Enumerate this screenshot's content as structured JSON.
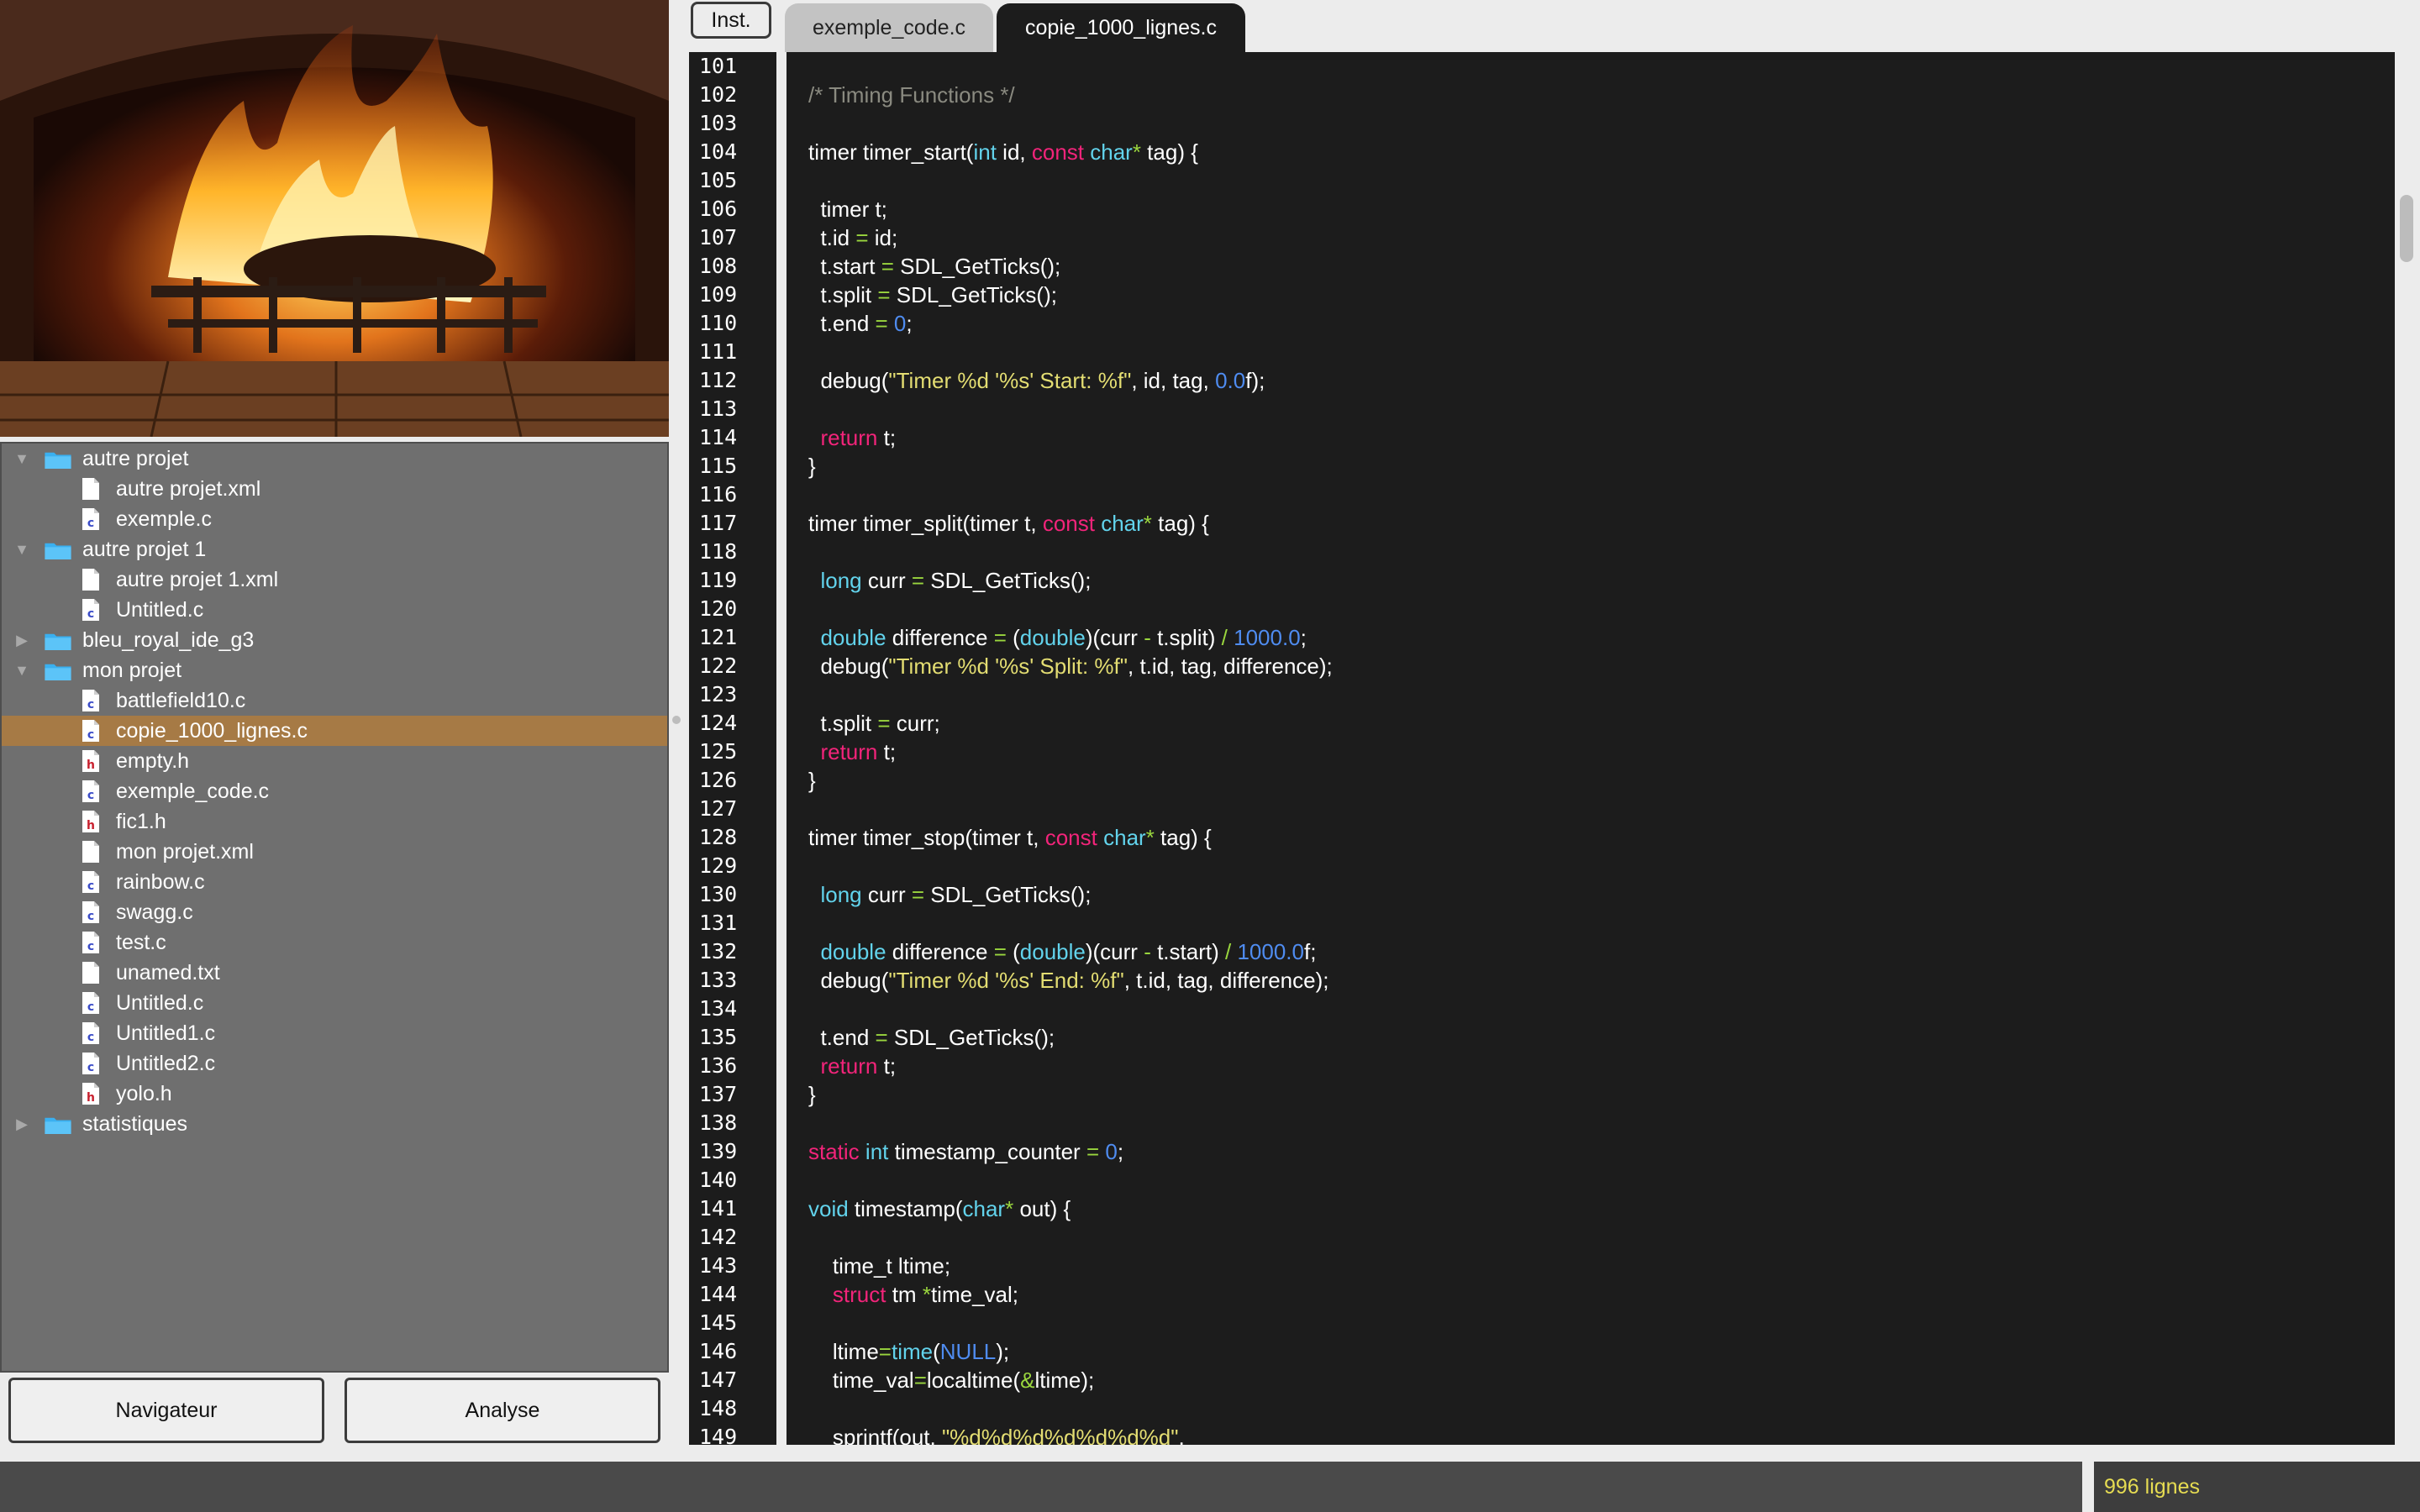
{
  "tabs": {
    "inst_label": "Inst.",
    "items": [
      {
        "label": "exemple_code.c",
        "active": false
      },
      {
        "label": "copie_1000_lignes.c",
        "active": true
      }
    ]
  },
  "tree": [
    {
      "type": "folder",
      "label": "autre projet",
      "expanded": true,
      "depth": 0
    },
    {
      "type": "file",
      "kind": "xml",
      "label": "autre projet.xml",
      "depth": 1
    },
    {
      "type": "file",
      "kind": "c",
      "label": "exemple.c",
      "depth": 1
    },
    {
      "type": "folder",
      "label": "autre projet 1",
      "expanded": true,
      "depth": 0
    },
    {
      "type": "file",
      "kind": "xml",
      "label": "autre projet 1.xml",
      "depth": 1
    },
    {
      "type": "file",
      "kind": "c",
      "label": "Untitled.c",
      "depth": 1
    },
    {
      "type": "folder",
      "label": "bleu_royal_ide_g3",
      "expanded": false,
      "depth": 0
    },
    {
      "type": "folder",
      "label": "mon projet",
      "expanded": true,
      "depth": 0
    },
    {
      "type": "file",
      "kind": "c",
      "label": "battlefield10.c",
      "depth": 1
    },
    {
      "type": "file",
      "kind": "c",
      "label": "copie_1000_lignes.c",
      "depth": 1,
      "selected": true
    },
    {
      "type": "file",
      "kind": "h",
      "label": "empty.h",
      "depth": 1
    },
    {
      "type": "file",
      "kind": "c",
      "label": "exemple_code.c",
      "depth": 1
    },
    {
      "type": "file",
      "kind": "h",
      "label": "fic1.h",
      "depth": 1
    },
    {
      "type": "file",
      "kind": "xml",
      "label": "mon projet.xml",
      "depth": 1
    },
    {
      "type": "file",
      "kind": "c",
      "label": "rainbow.c",
      "depth": 1
    },
    {
      "type": "file",
      "kind": "c",
      "label": "swagg.c",
      "depth": 1
    },
    {
      "type": "file",
      "kind": "c",
      "label": "test.c",
      "depth": 1
    },
    {
      "type": "file",
      "kind": "txt",
      "label": "unamed.txt",
      "depth": 1
    },
    {
      "type": "file",
      "kind": "c",
      "label": "Untitled.c",
      "depth": 1
    },
    {
      "type": "file",
      "kind": "c",
      "label": "Untitled1.c",
      "depth": 1
    },
    {
      "type": "file",
      "kind": "c",
      "label": "Untitled2.c",
      "depth": 1
    },
    {
      "type": "file",
      "kind": "h",
      "label": "yolo.h",
      "depth": 1
    },
    {
      "type": "folder",
      "label": "statistiques",
      "expanded": false,
      "depth": 0
    }
  ],
  "buttons": {
    "navigator": "Navigateur",
    "analysis": "Analyse"
  },
  "status": {
    "line_count": "996 lignes"
  },
  "colors": {
    "keyword": "#f2247a",
    "type": "#62d3ec",
    "number": "#4f8cf0",
    "string": "#e3dd72",
    "comment": "#8a8a80",
    "operator": "#9ad63e",
    "selection": "#a67a45"
  },
  "editor": {
    "first_line": 101,
    "lines": [
      [],
      [
        [
          "comment",
          "/* Timing Functions */"
        ]
      ],
      [],
      [
        [
          "plain",
          "timer timer_start("
        ],
        [
          "type",
          "int"
        ],
        [
          "plain",
          " id, "
        ],
        [
          "keyword",
          "const"
        ],
        [
          "plain",
          " "
        ],
        [
          "type",
          "char"
        ],
        [
          "op",
          "*"
        ],
        [
          "plain",
          " tag) {"
        ]
      ],
      [],
      [
        [
          "plain",
          "  timer t;"
        ]
      ],
      [
        [
          "plain",
          "  t.id "
        ],
        [
          "op",
          "="
        ],
        [
          "plain",
          " id;"
        ]
      ],
      [
        [
          "plain",
          "  t.start "
        ],
        [
          "op",
          "="
        ],
        [
          "plain",
          " SDL_GetTicks();"
        ]
      ],
      [
        [
          "plain",
          "  t.split "
        ],
        [
          "op",
          "="
        ],
        [
          "plain",
          " SDL_GetTicks();"
        ]
      ],
      [
        [
          "plain",
          "  t.end "
        ],
        [
          "op",
          "="
        ],
        [
          "plain",
          " "
        ],
        [
          "number",
          "0"
        ],
        [
          "plain",
          ";"
        ]
      ],
      [],
      [
        [
          "plain",
          "  debug("
        ],
        [
          "string",
          "\"Timer %d '%s' Start: %f\""
        ],
        [
          "plain",
          ", id, tag, "
        ],
        [
          "number",
          "0.0"
        ],
        [
          "plain",
          "f);"
        ]
      ],
      [],
      [
        [
          "plain",
          "  "
        ],
        [
          "keyword",
          "return"
        ],
        [
          "plain",
          " t;"
        ]
      ],
      [
        [
          "plain",
          "}"
        ]
      ],
      [],
      [
        [
          "plain",
          "timer timer_split(timer t, "
        ],
        [
          "keyword",
          "const"
        ],
        [
          "plain",
          " "
        ],
        [
          "type",
          "char"
        ],
        [
          "op",
          "*"
        ],
        [
          "plain",
          " tag) {"
        ]
      ],
      [],
      [
        [
          "plain",
          "  "
        ],
        [
          "type",
          "long"
        ],
        [
          "plain",
          " curr "
        ],
        [
          "op",
          "="
        ],
        [
          "plain",
          " SDL_GetTicks();"
        ]
      ],
      [],
      [
        [
          "plain",
          "  "
        ],
        [
          "type",
          "double"
        ],
        [
          "plain",
          " difference "
        ],
        [
          "op",
          "="
        ],
        [
          "plain",
          " ("
        ],
        [
          "type",
          "double"
        ],
        [
          "plain",
          ")(curr "
        ],
        [
          "op",
          "-"
        ],
        [
          "plain",
          " t.split) "
        ],
        [
          "op",
          "/"
        ],
        [
          "plain",
          " "
        ],
        [
          "number",
          "1000.0"
        ],
        [
          "plain",
          ";"
        ]
      ],
      [
        [
          "plain",
          "  debug("
        ],
        [
          "string",
          "\"Timer %d '%s' Split: %f\""
        ],
        [
          "plain",
          ", t.id, tag, difference);"
        ]
      ],
      [],
      [
        [
          "plain",
          "  t.split "
        ],
        [
          "op",
          "="
        ],
        [
          "plain",
          " curr;"
        ]
      ],
      [
        [
          "plain",
          "  "
        ],
        [
          "keyword",
          "return"
        ],
        [
          "plain",
          " t;"
        ]
      ],
      [
        [
          "plain",
          "}"
        ]
      ],
      [],
      [
        [
          "plain",
          "timer timer_stop(timer t, "
        ],
        [
          "keyword",
          "const"
        ],
        [
          "plain",
          " "
        ],
        [
          "type",
          "char"
        ],
        [
          "op",
          "*"
        ],
        [
          "plain",
          " tag) {"
        ]
      ],
      [],
      [
        [
          "plain",
          "  "
        ],
        [
          "type",
          "long"
        ],
        [
          "plain",
          " curr "
        ],
        [
          "op",
          "="
        ],
        [
          "plain",
          " SDL_GetTicks();"
        ]
      ],
      [],
      [
        [
          "plain",
          "  "
        ],
        [
          "type",
          "double"
        ],
        [
          "plain",
          " difference "
        ],
        [
          "op",
          "="
        ],
        [
          "plain",
          " ("
        ],
        [
          "type",
          "double"
        ],
        [
          "plain",
          ")(curr "
        ],
        [
          "op",
          "-"
        ],
        [
          "plain",
          " t.start) "
        ],
        [
          "op",
          "/"
        ],
        [
          "plain",
          " "
        ],
        [
          "number",
          "1000.0"
        ],
        [
          "plain",
          "f;"
        ]
      ],
      [
        [
          "plain",
          "  debug("
        ],
        [
          "string",
          "\"Timer %d '%s' End: %f\""
        ],
        [
          "plain",
          ", t.id, tag, difference);"
        ]
      ],
      [],
      [
        [
          "plain",
          "  t.end "
        ],
        [
          "op",
          "="
        ],
        [
          "plain",
          " SDL_GetTicks();"
        ]
      ],
      [
        [
          "plain",
          "  "
        ],
        [
          "keyword",
          "return"
        ],
        [
          "plain",
          " t;"
        ]
      ],
      [
        [
          "plain",
          "}"
        ]
      ],
      [],
      [
        [
          "keyword",
          "static"
        ],
        [
          "plain",
          " "
        ],
        [
          "type",
          "int"
        ],
        [
          "plain",
          " timestamp_counter "
        ],
        [
          "op",
          "="
        ],
        [
          "plain",
          " "
        ],
        [
          "number",
          "0"
        ],
        [
          "plain",
          ";"
        ]
      ],
      [],
      [
        [
          "type",
          "void"
        ],
        [
          "plain",
          " timestamp("
        ],
        [
          "type",
          "char"
        ],
        [
          "op",
          "*"
        ],
        [
          "plain",
          " out) {"
        ]
      ],
      [],
      [
        [
          "plain",
          "    time_t ltime;"
        ]
      ],
      [
        [
          "plain",
          "    "
        ],
        [
          "keyword",
          "struct"
        ],
        [
          "plain",
          " tm "
        ],
        [
          "op",
          "*"
        ],
        [
          "plain",
          "time_val;"
        ]
      ],
      [],
      [
        [
          "plain",
          "    ltime"
        ],
        [
          "op",
          "="
        ],
        [
          "type",
          "time"
        ],
        [
          "plain",
          "("
        ],
        [
          "number",
          "NULL"
        ],
        [
          "plain",
          ");"
        ]
      ],
      [
        [
          "plain",
          "    time_val"
        ],
        [
          "op",
          "="
        ],
        [
          "plain",
          "localtime("
        ],
        [
          "op",
          "&"
        ],
        [
          "plain",
          "ltime);"
        ]
      ],
      [],
      [
        [
          "plain",
          "    sprintf(out, "
        ],
        [
          "string",
          "\"%d%d%d%d%d%d%d\""
        ],
        [
          "plain",
          ","
        ]
      ]
    ]
  }
}
